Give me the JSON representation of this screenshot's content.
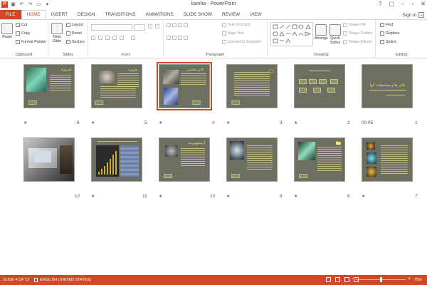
{
  "window": {
    "title": "kaniha - PowerPoint"
  },
  "signin": {
    "label": "Sign in"
  },
  "tabs": [
    "FILE",
    "HOME",
    "INSERT",
    "DESIGN",
    "TRANSITIONS",
    "ANIMATIONS",
    "SLIDE SHOW",
    "REVIEW",
    "VIEW"
  ],
  "ribbon": {
    "clipboard": {
      "paste": "Paste",
      "cut": "Cut",
      "copy": "Copy",
      "format_painter": "Format Painter",
      "label": "Clipboard"
    },
    "slides": {
      "new_slide": "New",
      "new_slide_2": "Slide",
      "layout": "Layout",
      "reset": "Reset",
      "section": "Section",
      "label": "Slides"
    },
    "font": {
      "label": "Font"
    },
    "paragraph": {
      "text_direction": "Text Direction",
      "align_text": "Align Text",
      "smartart": "Convert to SmartArt",
      "label": "Paragraph"
    },
    "drawing": {
      "arrange": "Arrange",
      "quick_styles": "Quick",
      "quick_styles_2": "Styles",
      "shape_fill": "Shape Fill",
      "shape_outline": "Shape Outline",
      "shape_effects": "Shape Effects",
      "label": "Drawing"
    },
    "editing": {
      "find": "Find",
      "replace": "Replace",
      "select": "Select",
      "label": "Editing"
    }
  },
  "slides": [
    {
      "num": "1",
      "marker": "",
      "timing": "00:05",
      "title": "کانی ها و مشخصات آنها",
      "selected": false
    },
    {
      "num": "2",
      "marker": "★",
      "title": "",
      "selected": false
    },
    {
      "num": "3",
      "marker": "★",
      "title": "",
      "selected": false
    },
    {
      "num": "4",
      "marker": "★",
      "title": "کانی شناسی",
      "selected": true
    },
    {
      "num": "5",
      "marker": "★",
      "title": "فیروزه",
      "selected": false
    },
    {
      "num": "6",
      "marker": "★",
      "title": "فیروزه",
      "selected": false
    },
    {
      "num": "7",
      "marker": "★",
      "title": "",
      "selected": false
    },
    {
      "num": "8",
      "marker": "★",
      "title": "",
      "selected": false
    },
    {
      "num": "9",
      "marker": "★",
      "title": "",
      "selected": false
    },
    {
      "num": "10",
      "marker": "★",
      "title": "آرسنوپیریت",
      "selected": false
    },
    {
      "num": "11",
      "marker": "★",
      "title": "",
      "selected": false
    },
    {
      "num": "12",
      "marker": "",
      "title": "",
      "selected": false
    }
  ],
  "status": {
    "slide": "SLIDE 4 OF 12",
    "language": "ENGLISH (UNITED STATES)",
    "zoom": "75%",
    "zoom_fraction": 0.5
  },
  "colors": {
    "accent": "#d24726",
    "slide_bg": "#6d6f60",
    "slide_title": "#f5e66a"
  }
}
